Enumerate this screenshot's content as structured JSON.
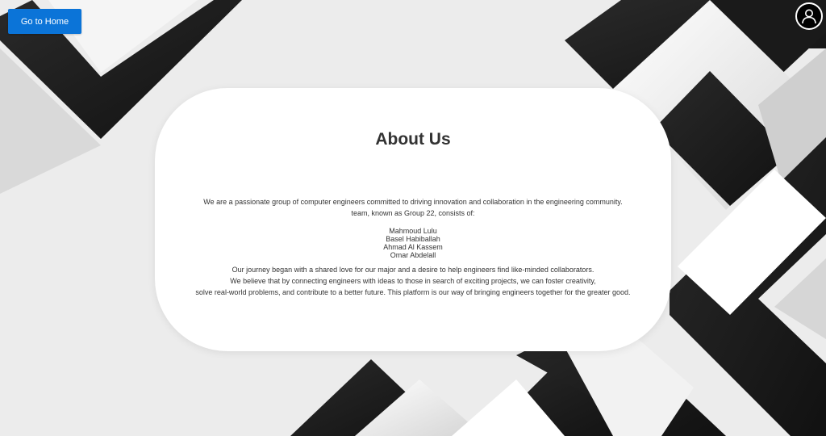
{
  "nav": {
    "home_label": "Go to Home"
  },
  "profile": {
    "icon": "user-profile-icon"
  },
  "about": {
    "title": "About Us",
    "intro_lines": [
      "We are a passionate group of computer engineers committed to driving innovation and collaboration in the engineering community.",
      "team, known as Group 22, consists of:"
    ],
    "members": [
      "Mahmoud Lulu",
      "Basel Habiballah",
      "Ahmad Al Kassem",
      "Omar Abdelall"
    ],
    "journey_lines": [
      "Our journey began with a shared love for our major and a desire to help engineers find like-minded collaborators.",
      "We believe that by connecting engineers with ideas to those in search of exciting projects, we can foster creativity,",
      "solve real-world problems, and contribute to a better future. This platform is our way of bringing engineers together for the greater good."
    ]
  },
  "colors": {
    "accent": "#0b74d8",
    "card": "#ffffff",
    "dark": "#1c1c1c"
  }
}
